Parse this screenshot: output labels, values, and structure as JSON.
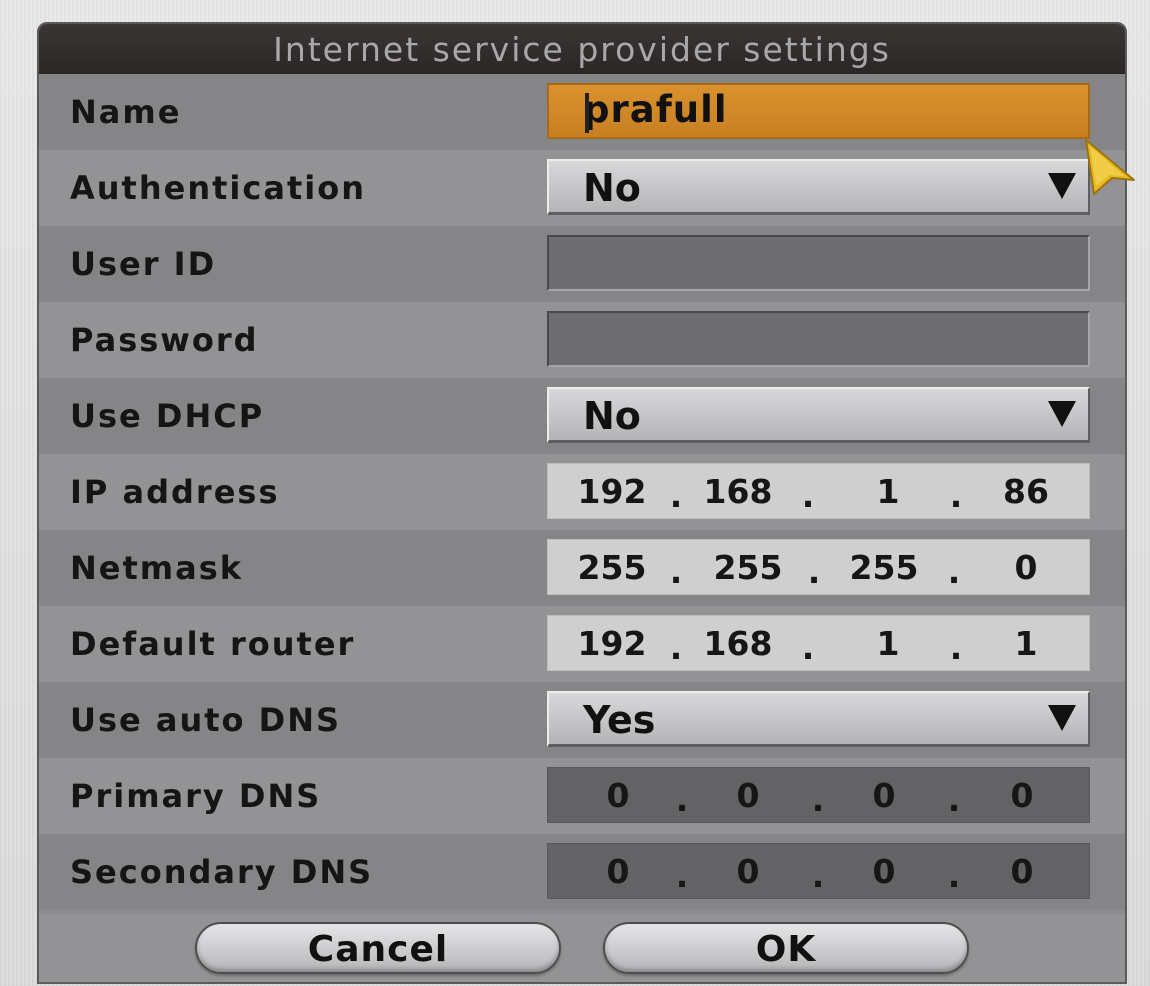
{
  "dialog": {
    "title": "Internet service provider settings"
  },
  "fields": {
    "name": {
      "label": "Name",
      "value": "prafull"
    },
    "authentication": {
      "label": "Authentication",
      "value": "No"
    },
    "user_id": {
      "label": "User ID",
      "value": ""
    },
    "password": {
      "label": "Password",
      "value": ""
    },
    "use_dhcp": {
      "label": "Use DHCP",
      "value": "No"
    },
    "ip_address": {
      "label": "IP address",
      "parts": [
        "192",
        "168",
        "1",
        "86"
      ]
    },
    "netmask": {
      "label": "Netmask",
      "parts": [
        "255",
        "255",
        "255",
        "0"
      ]
    },
    "default_router": {
      "label": "Default router",
      "parts": [
        "192",
        "168",
        "1",
        "1"
      ]
    },
    "use_auto_dns": {
      "label": "Use auto DNS",
      "value": "Yes"
    },
    "primary_dns": {
      "label": "Primary DNS",
      "parts": [
        "0",
        "0",
        "0",
        "0"
      ]
    },
    "secondary_dns": {
      "label": "Secondary DNS",
      "parts": [
        "0",
        "0",
        "0",
        "0"
      ]
    }
  },
  "buttons": {
    "cancel": "Cancel",
    "ok": "OK"
  },
  "icons": {
    "dropdown": "triangle-down-icon",
    "pointer": "mouse-pointer-icon"
  },
  "colors": {
    "active_field": "#d08a2a",
    "title_bar": "#2f2b2b",
    "pointer": "#e8b820"
  }
}
